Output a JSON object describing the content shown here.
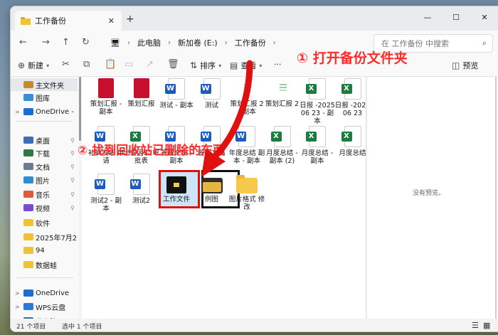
{
  "window": {
    "tab_title": "工作备份",
    "tab_close": "✕",
    "new_tab": "+",
    "controls": [
      "—",
      "☐",
      "✕"
    ]
  },
  "nav": {
    "back": "←",
    "forward": "→",
    "up": "↑",
    "refresh": "↻"
  },
  "breadcrumb": [
    "此电脑",
    "新加卷 (E:)",
    "工作备份"
  ],
  "search": {
    "placeholder": "在 工作备份 中搜索"
  },
  "toolbar": {
    "new_label": "新建",
    "sort_label": "排序",
    "view_label": "查看",
    "more": "···",
    "preview_label": "预览"
  },
  "annotations": {
    "step1": "① 打开备份文件夹",
    "step2": "② 找到回收站已删除的东西"
  },
  "sidebar": {
    "items": [
      {
        "label": "主文件夹",
        "icon": "home-icon",
        "chevron": ""
      },
      {
        "label": "图库",
        "icon": "gallery-icon",
        "chevron": ""
      },
      {
        "label": "OneDrive -",
        "icon": "onedrive-icon",
        "chevron": ">"
      },
      {
        "label": "桌面",
        "icon": "desktop-icon",
        "chevron": "",
        "pin": "📌"
      },
      {
        "label": "下载",
        "icon": "download-icon",
        "chevron": "",
        "pin": "📌"
      },
      {
        "label": "文档",
        "icon": "documents-icon",
        "chevron": "",
        "pin": "📌"
      },
      {
        "label": "图片",
        "icon": "pictures-icon",
        "chevron": "",
        "pin": "📌"
      },
      {
        "label": "音乐",
        "icon": "music-icon",
        "chevron": "",
        "pin": "📌"
      },
      {
        "label": "视频",
        "icon": "videos-icon",
        "chevron": "",
        "pin": "📌"
      },
      {
        "label": "软件",
        "icon": "folder-icon",
        "chevron": ""
      },
      {
        "label": "2025年7月2",
        "icon": "folder-icon",
        "chevron": ""
      },
      {
        "label": "94",
        "icon": "folder-icon",
        "chevron": ""
      },
      {
        "label": "数据蛙",
        "icon": "folder-icon",
        "chevron": ""
      },
      {
        "label": "OneDrive",
        "icon": "onedrive-icon",
        "chevron": ">"
      },
      {
        "label": "WPS云盘",
        "icon": "cloud-icon",
        "chevron": ">"
      },
      {
        "label": "此电脑",
        "icon": "pc-icon",
        "chevron": ">"
      }
    ]
  },
  "files": [
    {
      "label": "策划汇报 - 副本",
      "type": "red"
    },
    {
      "label": "策划汇报",
      "type": "red"
    },
    {
      "label": "测试 - 副本",
      "type": "word"
    },
    {
      "label": "测试",
      "type": "word"
    },
    {
      "label": "策划汇报 2 - 副本",
      "type": "file"
    },
    {
      "label": "策划汇报 2",
      "type": "file"
    },
    {
      "label": "日报 -202506 23 - 副本",
      "type": "excel"
    },
    {
      "label": "日报 -202506 23",
      "type": "excel"
    },
    {
      "label": "补换发证 申请",
      "type": "word"
    },
    {
      "label": "出差因公 审批表",
      "type": "excel"
    },
    {
      "label": "答辩文稿 - 副本",
      "type": "word"
    },
    {
      "label": "答辩文稿",
      "type": "word"
    },
    {
      "label": "年度总结 副本 - 副本",
      "type": "word"
    },
    {
      "label": "月度总结 - 副本 (2)",
      "type": "excel"
    },
    {
      "label": "月度总结 - 副本",
      "type": "excel"
    },
    {
      "label": "月度总结",
      "type": "excel"
    },
    {
      "label": "测试2 - 副本",
      "type": "word"
    },
    {
      "label": "测试2",
      "type": "word"
    },
    {
      "label": "工作文件",
      "type": "blackfolder"
    },
    {
      "label": "例图",
      "type": "darkfolder"
    },
    {
      "label": "图片格式 修改",
      "type": "folder"
    }
  ],
  "preview": {
    "empty_text": "没有预览。"
  },
  "status": {
    "count": "21 个项目",
    "selected": "选中 1 个项目"
  },
  "colors": {
    "annotation": "#ff2a2a",
    "selection_border": "#e01010",
    "word": "#1d5bbf",
    "excel": "#1f7a3e"
  }
}
